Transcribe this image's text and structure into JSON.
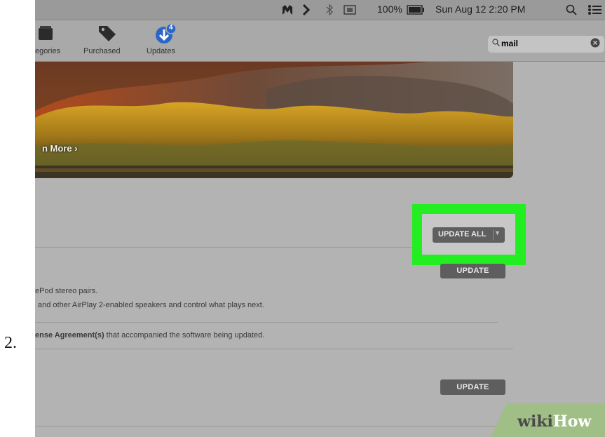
{
  "step_number": "2.",
  "menubar": {
    "battery": "100%",
    "datetime": "Sun Aug 12  2:20 PM",
    "icons": [
      "malwarebytes-icon",
      "chevron-icon",
      "bluetooth-icon",
      "display-icon",
      "battery-icon",
      "spotlight-icon",
      "list-icon"
    ]
  },
  "toolbar": {
    "categories_label": "egories",
    "purchased_label": "Purchased",
    "updates_label": "Updates",
    "updates_badge": "4"
  },
  "search": {
    "value": "mail"
  },
  "banner": {
    "link_text": "n More ›"
  },
  "updates": [
    {
      "button_label": "UPDATE",
      "description_lines": [
        "ePod stereo pairs.",
        "and other AirPlay 2-enabled speakers and control what plays next."
      ],
      "license_bold": "ense Agreement(s)",
      "license_rest": " that accompanied the software being updated."
    },
    {
      "button_label": "UPDATE"
    }
  ],
  "update_all": {
    "label": "UPDATE ALL",
    "caret": "▾"
  },
  "watermark": {
    "wiki": "wiki",
    "how": "How"
  },
  "colors": {
    "highlight": "#22ee22",
    "button": "#5e5e5e",
    "badge": "#2a66c9"
  }
}
